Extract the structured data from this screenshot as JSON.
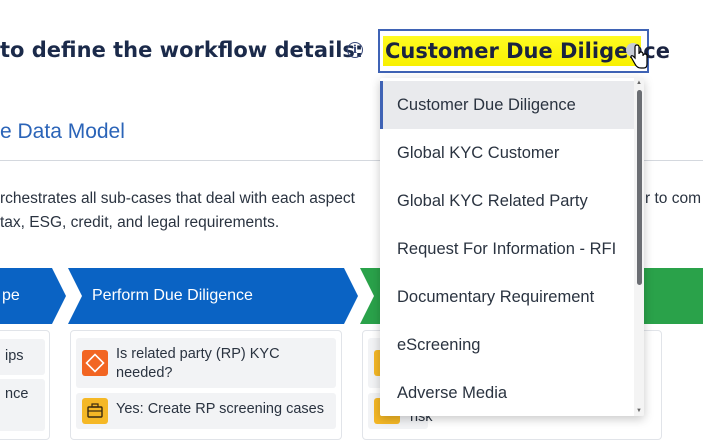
{
  "header": {
    "heading": "to define the workflow details:",
    "info_icon": "i"
  },
  "select": {
    "value": "Customer Due Diligence"
  },
  "section": {
    "subheading": "e Data Model",
    "para_line1": "rchestrates all sub-cases that deal with each aspect",
    "para_line2": "tax, ESG, credit, and legal requirements.",
    "para_right": "r to com"
  },
  "stages": [
    {
      "title": "pe"
    },
    {
      "title": "Perform Due Diligence"
    }
  ],
  "left_card": {
    "item1": "ips",
    "item2": "nce"
  },
  "main_card": {
    "task1_line1": "Is related party (RP) KYC",
    "task1_line2": "needed?",
    "task2": "Yes: Create RP screening cases"
  },
  "right_card": {
    "task_text": "risk"
  },
  "dropdown": {
    "options": [
      "Customer Due Diligence",
      "Global KYC Customer",
      "Global KYC Related Party",
      "Request For Information - RFI",
      "Documentary Requirement",
      "eScreening",
      "Adverse Media"
    ]
  },
  "colors": {
    "accent": "#3f63b5",
    "stage_blue": "#0a63c4",
    "stage_green": "#2aa24a",
    "highlight": "#fffb22",
    "task_orange": "#f26522",
    "task_yellow": "#f5b826"
  }
}
